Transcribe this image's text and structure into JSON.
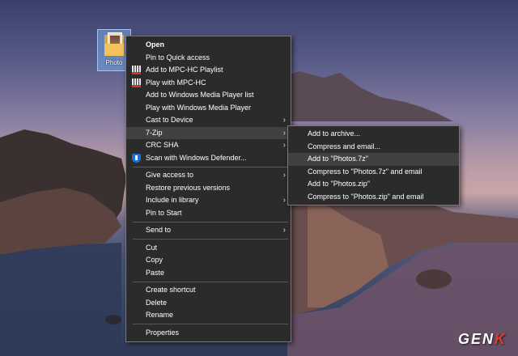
{
  "desktop": {
    "file_label": "Photo",
    "watermark_prefix": "GEN",
    "watermark_suffix": "K"
  },
  "context_menu": {
    "groups": [
      [
        {
          "label": "Open",
          "bold": true
        },
        {
          "label": "Pin to Quick access"
        },
        {
          "label": "Add to MPC-HC Playlist",
          "icon": "mpc-hc-icon"
        },
        {
          "label": "Play with MPC-HC",
          "icon": "mpc-hc-icon"
        },
        {
          "label": "Add to Windows Media Player list"
        },
        {
          "label": "Play with Windows Media Player"
        },
        {
          "label": "Cast to Device",
          "submenu": true
        },
        {
          "label": "7-Zip",
          "submenu": true,
          "highlighted": true
        },
        {
          "label": "CRC SHA",
          "submenu": true
        },
        {
          "label": "Scan with Windows Defender...",
          "icon": "windows-defender-shield-icon"
        }
      ],
      [
        {
          "label": "Give access to",
          "submenu": true
        },
        {
          "label": "Restore previous versions"
        },
        {
          "label": "Include in library",
          "submenu": true
        },
        {
          "label": "Pin to Start"
        }
      ],
      [
        {
          "label": "Send to",
          "submenu": true
        }
      ],
      [
        {
          "label": "Cut"
        },
        {
          "label": "Copy"
        },
        {
          "label": "Paste"
        }
      ],
      [
        {
          "label": "Create shortcut"
        },
        {
          "label": "Delete"
        },
        {
          "label": "Rename"
        }
      ],
      [
        {
          "label": "Properties"
        }
      ]
    ]
  },
  "submenu_7zip": {
    "items": [
      {
        "label": "Add to archive..."
      },
      {
        "label": "Compress and email..."
      },
      {
        "label": "Add to \"Photos.7z\"",
        "highlighted": true
      },
      {
        "label": "Compress to \"Photos.7z\" and email"
      },
      {
        "label": "Add to \"Photos.zip\""
      },
      {
        "label": "Compress to \"Photos.zip\" and email"
      }
    ]
  },
  "colors": {
    "menu_bg": "#2b2b2b",
    "menu_border": "#7a7a7a",
    "highlight": "#414141",
    "watermark_accent": "#e03a2f"
  }
}
